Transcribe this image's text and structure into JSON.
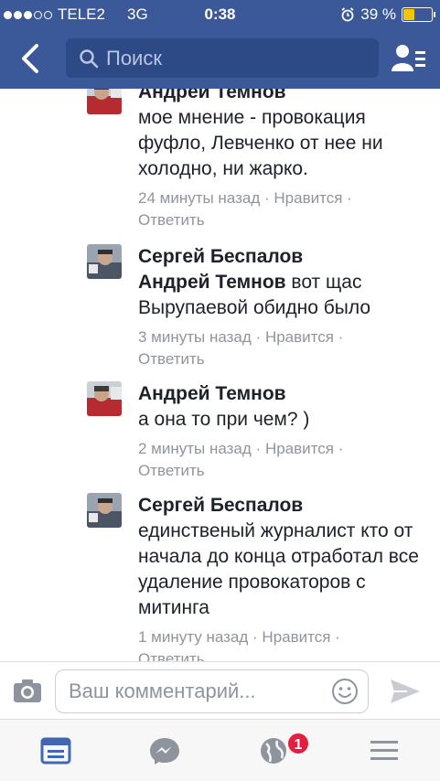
{
  "status_bar": {
    "carrier": "TELE2",
    "network": "3G",
    "time": "0:38",
    "battery": "39 %",
    "battery_level": 0.39
  },
  "header": {
    "search_placeholder": "Поиск",
    "accent_color": "#3b5998"
  },
  "comments": [
    {
      "author": "Андрей Темнов",
      "text": "мое мнение - провокация фуфло, Левченко от нее ни холодно, ни жарко.",
      "time": "24 минуты назад",
      "like": "Нравится",
      "reply": "Ответить"
    },
    {
      "author": "Сергей Беспалов",
      "mention": "Андрей Темнов",
      "text": "вот щас Вырупаевой обидно было",
      "time": "3 минуты назад",
      "like": "Нравится",
      "reply": "Ответить"
    },
    {
      "author": "Андрей Темнов",
      "text": "а она то при чем? )",
      "time": "2 минуты назад",
      "like": "Нравится",
      "reply": "Ответить"
    },
    {
      "author": "Сергей Беспалов",
      "text": "единственый журналист кто от начала до конца отработал все удаление провокаторов с митинга",
      "time": "1 минуту назад",
      "like": "Нравится",
      "reply": "Ответить"
    }
  ],
  "composer": {
    "placeholder": "Ваш комментарий..."
  },
  "tabbar": {
    "notifications_badge": "1",
    "icons": [
      "news-feed-icon",
      "messenger-icon",
      "notifications-globe-icon",
      "menu-icon"
    ]
  },
  "separator": "·"
}
